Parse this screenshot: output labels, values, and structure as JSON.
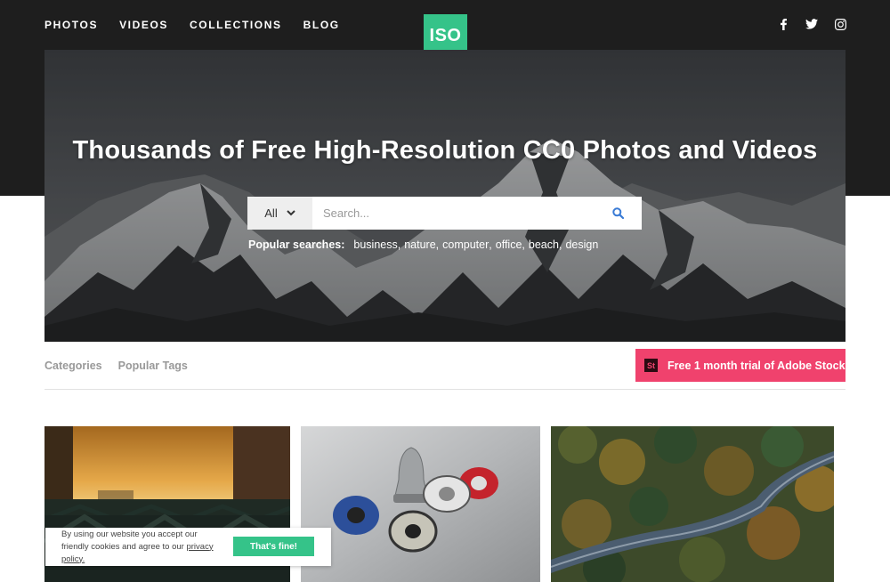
{
  "nav": {
    "items": [
      "PHOTOS",
      "VIDEOS",
      "COLLECTIONS",
      "BLOG"
    ]
  },
  "logo": {
    "text": "ISO",
    "color": "#35c389"
  },
  "social": [
    "facebook-icon",
    "twitter-icon",
    "instagram-icon"
  ],
  "hero": {
    "title": "Thousands of Free High-Resolution CC0 Photos and Videos",
    "search": {
      "filter_value": "All",
      "placeholder": "Search..."
    },
    "popular_label": "Popular searches:",
    "popular_terms": [
      "business",
      "nature",
      "computer",
      "office",
      "beach",
      "design"
    ]
  },
  "subnav": {
    "categories": "Categories",
    "popular_tags": "Popular Tags"
  },
  "stock_button": {
    "badge": "St",
    "label": "Free 1 month trial of Adobe Stock",
    "color": "#f0426d"
  },
  "cookie": {
    "message_before": "By using our website you accept our friendly cookies and agree to our ",
    "link": "privacy policy.",
    "button": "That's fine!"
  },
  "colors": {
    "header_bg": "#1e1e1e",
    "accent": "#35c389",
    "stock": "#f0426d"
  }
}
